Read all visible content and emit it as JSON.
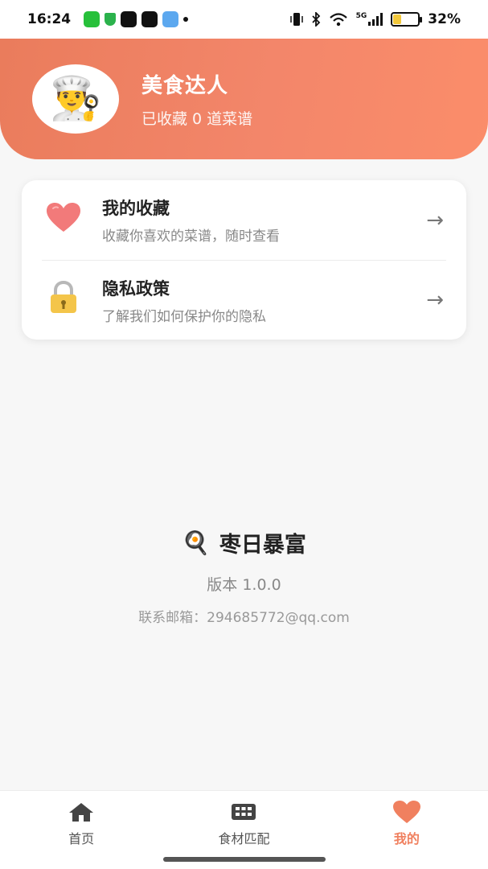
{
  "status_bar": {
    "time": "16:24",
    "network": "5G",
    "battery_percent": "32%",
    "battery_level": 0.32
  },
  "profile": {
    "avatar_icon": "chef-avatar-icon",
    "name": "美食达人",
    "subtitle": "已收藏 0 道菜谱"
  },
  "menu": [
    {
      "icon": "heart-icon",
      "title": "我的收藏",
      "desc": "收藏你喜欢的菜谱，随时查看"
    },
    {
      "icon": "lock-icon",
      "title": "隐私政策",
      "desc": "了解我们如何保护你的隐私"
    }
  ],
  "about": {
    "logo_icon": "frying-pan-icon",
    "app_name": "枣日暴富",
    "version": "版本 1.0.0",
    "contact": "联系邮箱：294685772@qq.com"
  },
  "tabs": [
    {
      "icon": "home-icon",
      "label": "首页",
      "active": false
    },
    {
      "icon": "grid-icon",
      "label": "食材匹配",
      "active": false
    },
    {
      "icon": "heart-icon",
      "label": "我的",
      "active": true
    }
  ],
  "colors": {
    "accent": "#f0805f",
    "header_start": "#ea7c5c",
    "header_end": "#fb8d6a"
  }
}
